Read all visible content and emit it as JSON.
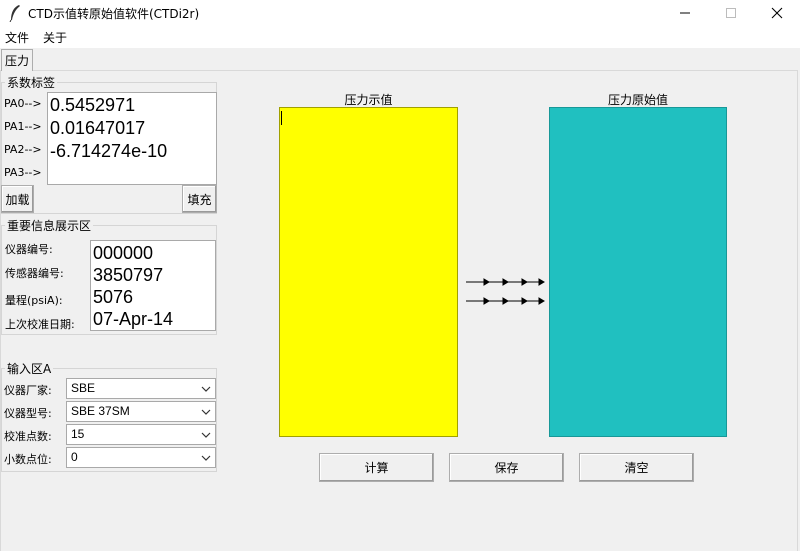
{
  "window": {
    "title": "CTD示值转原始值软件(CTDi2r)"
  },
  "menu": {
    "items": [
      "文件",
      "关于"
    ]
  },
  "tabs": [
    {
      "label": "压力"
    }
  ],
  "coefficients": {
    "group_title": "系数标签",
    "labels": [
      "PA0-->",
      "PA1-->",
      "PA2-->",
      "PA3-->"
    ],
    "values": [
      "0.5452971",
      "0.01647017",
      "-6.714274e-10",
      ""
    ],
    "load_button": "加载",
    "fill_button": "填充"
  },
  "info": {
    "group_title": "重要信息展示区",
    "labels": [
      "仪器编号:",
      "传感器编号:",
      "量程(psiA):",
      "上次校准日期:"
    ],
    "values": [
      "000000",
      "3850797",
      "5076",
      "07-Apr-14"
    ]
  },
  "input": {
    "group_title": "输入区A",
    "labels": [
      "仪器厂家:",
      "仪器型号:",
      "校准点数:",
      "小数点位:"
    ],
    "values": [
      "SBE",
      "SBE 37SM",
      "15",
      "0"
    ]
  },
  "canvases": {
    "left_label": "压力示值",
    "left_color": "#ffff00",
    "right_label": "压力原始值",
    "right_color": "#20c0c0"
  },
  "actions": {
    "compute": "计算",
    "save": "保存",
    "clear": "清空"
  },
  "icons": {
    "app": "feather-icon",
    "minimize": "minimize-icon",
    "maximize": "maximize-icon",
    "close": "close-icon",
    "dropdown": "chevron-down-icon",
    "arrow": "right-arrow-icon"
  }
}
